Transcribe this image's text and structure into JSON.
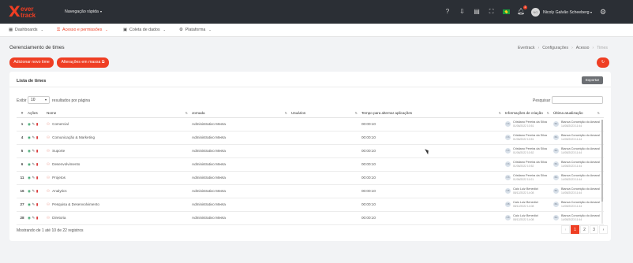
{
  "brand": {
    "line1": "ever",
    "line2": "track",
    "accent": "#ef3e23"
  },
  "topbar": {
    "quick_nav": "Navegação rápida",
    "icons": [
      "help-icon",
      "download-icon",
      "document-icon",
      "fullscreen-icon",
      "flag-icon",
      "bell-icon"
    ],
    "notification_count": "2",
    "user_initials": "NG",
    "user_name": "Nicoly Galvão Scheeberg"
  },
  "menu": {
    "items": [
      {
        "label": "Dashboards",
        "icon": "grid-icon"
      },
      {
        "label": "Acesso e permissões",
        "icon": "user-lock-icon",
        "active": true
      },
      {
        "label": "Coleta de dados",
        "icon": "clipboard-icon"
      },
      {
        "label": "Plataforma",
        "icon": "gear-icon"
      }
    ]
  },
  "page": {
    "title": "Gerenciamento de times",
    "breadcrumb": [
      "Evertrack",
      "Configurações",
      "Acesso",
      "Times"
    ],
    "add_button": "Adicionar novo time",
    "bulk_button": "Alterações em massa"
  },
  "card": {
    "title": "Lista de times",
    "export_label": "Exportar",
    "show_label": "Exibir",
    "page_size": "10",
    "per_page_label": "resultados por página",
    "search_label": "Pesquisar",
    "columns": [
      "#",
      "Ações",
      "Nome",
      "Jornada",
      "Usuários",
      "Tempo para alternar aplicações",
      "Informações de criação",
      "Última atualização"
    ],
    "rows": [
      {
        "id": "1",
        "name": "Comercial",
        "journey": "Administrativo Meeta",
        "time": "00:00:10",
        "created_by": "Cristiano Pereira da Silva",
        "created_at": "01/06/2022 10:51",
        "updated_by": "Bianca Conceição do Amaral",
        "updated_at": "14/05/2023 11:44",
        "created_initials": "CS",
        "updated_initials": "BA"
      },
      {
        "id": "4",
        "name": "Comunicação & Marketing",
        "journey": "Administrativo Meeta",
        "time": "00:00:10",
        "created_by": "Cristiano Pereira da Silva",
        "created_at": "01/06/2022 10:51",
        "updated_by": "Bianca Conceição do Amaral",
        "updated_at": "14/05/2023 11:44",
        "created_initials": "CS",
        "updated_initials": "BA"
      },
      {
        "id": "5",
        "name": "Suporte",
        "journey": "Administrativo Meeta",
        "time": "00:00:10",
        "created_by": "Cristiano Pereira da Silva",
        "created_at": "01/06/2022 10:52",
        "updated_by": "Bianca Conceição do Amaral",
        "updated_at": "14/05/2023 11:44",
        "created_initials": "CS",
        "updated_initials": "BA"
      },
      {
        "id": "6",
        "name": "Desenvolvimento",
        "journey": "Administrativo Meeta",
        "time": "00:00:10",
        "created_by": "Cristiano Pereira da Silva",
        "created_at": "01/06/2022 10:52",
        "updated_by": "Bianca Conceição do Amaral",
        "updated_at": "14/05/2023 11:44",
        "created_initials": "CS",
        "updated_initials": "BA"
      },
      {
        "id": "11",
        "name": "Projetos",
        "journey": "Administrativo Meeta",
        "time": "00:00:10",
        "created_by": "Cristiano Pereira da Silva",
        "created_at": "01/06/2022 11:01",
        "updated_by": "Bianca Conceição do Amaral",
        "updated_at": "14/05/2023 11:44",
        "created_initials": "CS",
        "updated_initials": "BA"
      },
      {
        "id": "16",
        "name": "Analytics",
        "journey": "Administrativo Meeta",
        "time": "00:00:10",
        "created_by": "Caio Luiz Benedict",
        "created_at": "08/12/2022 14:08",
        "updated_by": "Bianca Conceição do Amaral",
        "updated_at": "14/05/2023 11:44",
        "created_initials": "CB",
        "updated_initials": "BA"
      },
      {
        "id": "27",
        "name": "Pesquisa & Desenvolvimento",
        "journey": "Administrativo Meeta",
        "time": "00:00:10",
        "created_by": "Caio Luiz Benedict",
        "created_at": "08/12/2022 14:08",
        "updated_by": "Bianca Conceição do Amaral",
        "updated_at": "14/05/2023 11:44",
        "created_initials": "CB",
        "updated_initials": "BA"
      },
      {
        "id": "28",
        "name": "Diretoria",
        "journey": "Administrativo Meeta",
        "time": "00:00:10",
        "created_by": "Caio Luiz Benedict",
        "created_at": "08/12/2022 14:08",
        "updated_by": "Bianca Conceição do Amaral",
        "updated_at": "14/05/2023 11:44",
        "created_initials": "CB",
        "updated_initials": "BA"
      }
    ],
    "footer_info": "Mostrando de 1 até 10 de 22 registros",
    "pagination": {
      "prev": "‹",
      "pages": [
        "1",
        "2",
        "3"
      ],
      "next": "›",
      "current": "1"
    }
  }
}
